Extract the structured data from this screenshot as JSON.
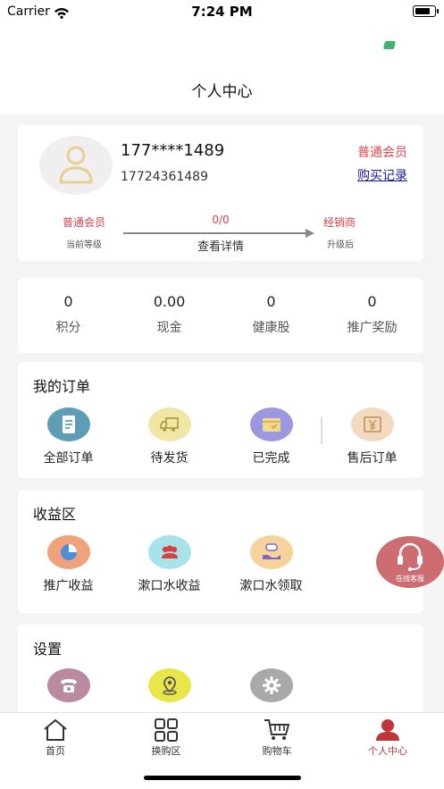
{
  "status_bar": {
    "carrier": "Carrier",
    "time": "7:24 PM"
  },
  "header": {
    "title": "个人中心"
  },
  "profile": {
    "phone_masked": "177****1489",
    "phone_full": "17724361489",
    "member_badge": "普通会员",
    "purchase_link": "购买记录",
    "level": {
      "current": "普通会员",
      "current_caption": "当前等级",
      "progress": "0/0",
      "detail_link": "查看详情",
      "next": "经销商",
      "next_caption": "升级后"
    }
  },
  "stats": [
    {
      "value": "0",
      "label": "积分"
    },
    {
      "value": "0.00",
      "label": "现金"
    },
    {
      "value": "0",
      "label": "健康股"
    },
    {
      "value": "0",
      "label": "推广奖励"
    }
  ],
  "orders": {
    "title": "我的订单",
    "items": [
      {
        "label": "全部订单",
        "icon": "document-icon",
        "color": "#5d9db5"
      },
      {
        "label": "待发货",
        "icon": "truck-icon",
        "color": "#f2e6a6"
      },
      {
        "label": "已完成",
        "icon": "wallet-icon",
        "color": "#9b97e0"
      },
      {
        "label": "售后订单",
        "icon": "yen-box-icon",
        "color": "#f3d9bf"
      }
    ]
  },
  "income": {
    "title": "收益区",
    "items": [
      {
        "label": "推广收益",
        "icon": "pie-chart-icon",
        "color": "#f0a27a"
      },
      {
        "label": "漱口水收益",
        "icon": "users-icon",
        "color": "#a8e3ea"
      },
      {
        "label": "漱口水领取",
        "icon": "hand-gift-icon",
        "color": "#f7d29b"
      }
    ]
  },
  "settings": {
    "title": "设置",
    "items": [
      {
        "label": "",
        "icon": "telephone-icon",
        "color": "#b98aa0"
      },
      {
        "label": "",
        "icon": "location-pin-icon",
        "color": "#e9e64a"
      },
      {
        "label": "",
        "icon": "gear-icon",
        "color": "#a9a9a9"
      }
    ]
  },
  "service": {
    "label": "在线客服",
    "color": "#c96065"
  },
  "tabbar": [
    {
      "label": "首页",
      "icon": "home-icon",
      "active": false
    },
    {
      "label": "换购区",
      "icon": "grid-icon",
      "active": false
    },
    {
      "label": "购物车",
      "icon": "cart-icon",
      "active": false
    },
    {
      "label": "个人中心",
      "icon": "person-icon",
      "active": true
    }
  ],
  "colors": {
    "accent": "#c0343c",
    "link": "#1a1aa6"
  }
}
